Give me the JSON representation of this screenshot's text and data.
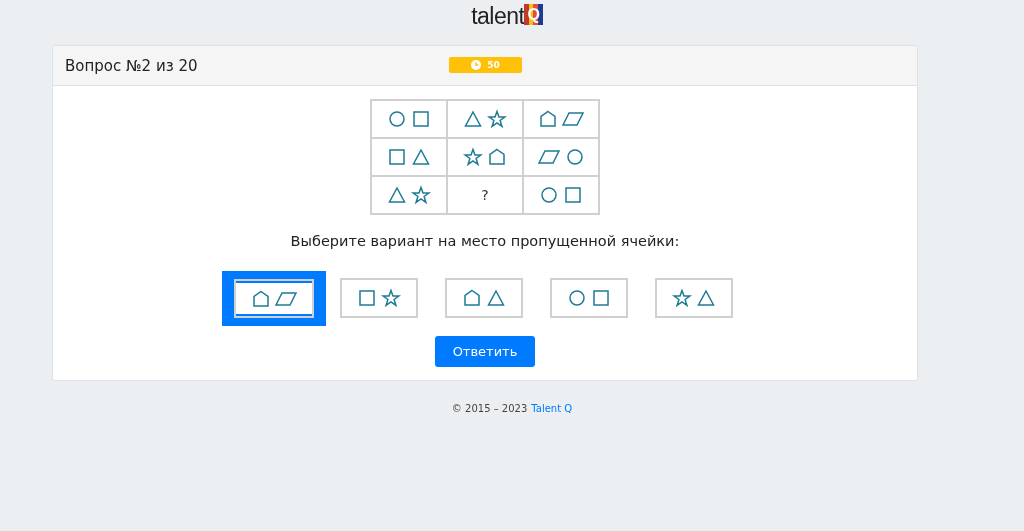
{
  "logo": {
    "word": "talent",
    "letter": "Q"
  },
  "header": {
    "title": "Вопрос №2 из 20",
    "timer": "50"
  },
  "grid": [
    [
      {
        "kind": "shapes",
        "shapes": [
          {
            "kind": "circle"
          },
          {
            "kind": "square"
          }
        ]
      },
      {
        "kind": "shapes",
        "shapes": [
          {
            "kind": "triangle"
          },
          {
            "kind": "star"
          }
        ]
      },
      {
        "kind": "shapes",
        "shapes": [
          {
            "kind": "pentagon"
          },
          {
            "kind": "parallelogram"
          }
        ]
      }
    ],
    [
      {
        "kind": "shapes",
        "shapes": [
          {
            "kind": "square"
          },
          {
            "kind": "triangle"
          }
        ]
      },
      {
        "kind": "shapes",
        "shapes": [
          {
            "kind": "star"
          },
          {
            "kind": "pentagon"
          }
        ]
      },
      {
        "kind": "shapes",
        "shapes": [
          {
            "kind": "parallelogram"
          },
          {
            "kind": "circle"
          }
        ]
      }
    ],
    [
      {
        "kind": "shapes",
        "shapes": [
          {
            "kind": "triangle"
          },
          {
            "kind": "star"
          }
        ]
      },
      {
        "kind": "text",
        "text": "?"
      },
      {
        "kind": "shapes",
        "shapes": [
          {
            "kind": "circle"
          },
          {
            "kind": "square"
          }
        ]
      }
    ]
  ],
  "prompt": "Выберите вариант на место пропущенной ячейки:",
  "options": [
    {
      "selected": true,
      "shapes": [
        {
          "kind": "pentagon"
        },
        {
          "kind": "parallelogram"
        }
      ]
    },
    {
      "selected": false,
      "shapes": [
        {
          "kind": "square"
        },
        {
          "kind": "star"
        }
      ]
    },
    {
      "selected": false,
      "shapes": [
        {
          "kind": "pentagon"
        },
        {
          "kind": "triangle"
        }
      ]
    },
    {
      "selected": false,
      "shapes": [
        {
          "kind": "circle"
        },
        {
          "kind": "square"
        }
      ]
    },
    {
      "selected": false,
      "shapes": [
        {
          "kind": "star"
        },
        {
          "kind": "triangle"
        }
      ]
    }
  ],
  "submit": "Ответить",
  "footer": {
    "copyright": "© 2015 – 2023",
    "link": "Talent Q"
  }
}
